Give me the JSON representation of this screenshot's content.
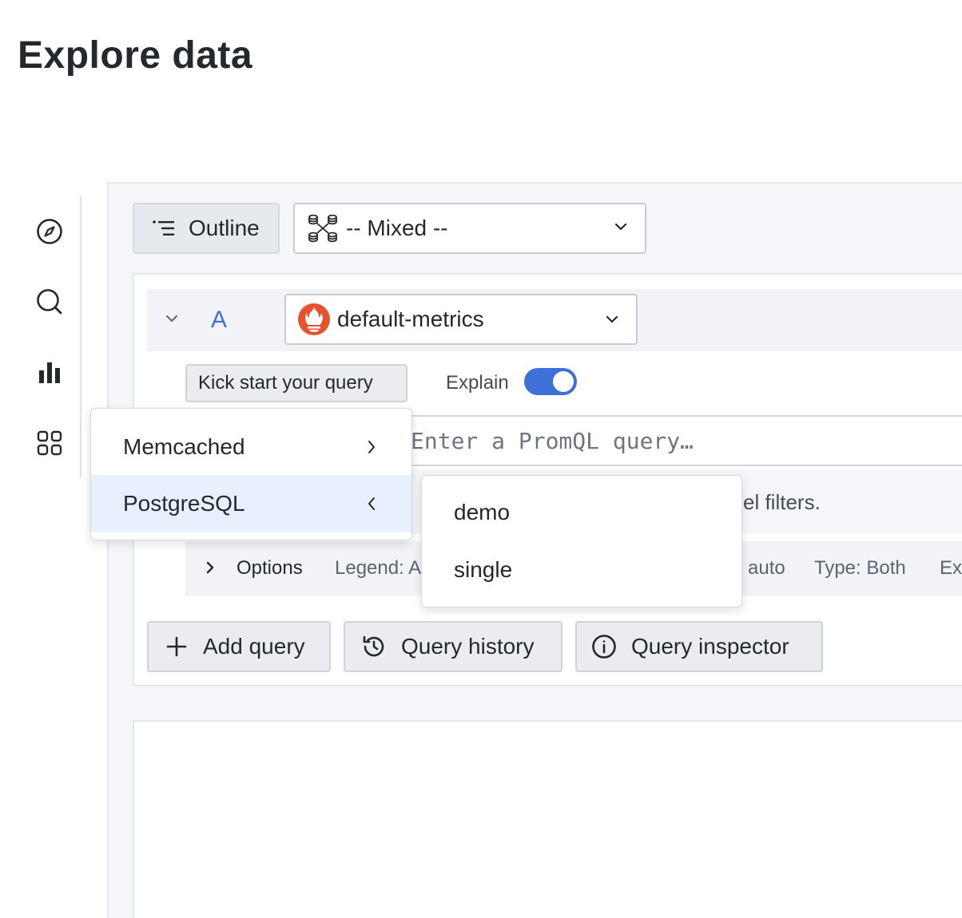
{
  "page": {
    "title": "Explore data"
  },
  "rail": {
    "items": [
      {
        "icon": "compass-icon"
      },
      {
        "icon": "search-icon"
      },
      {
        "icon": "bar-chart-icon"
      },
      {
        "icon": "apps-grid-icon"
      }
    ]
  },
  "toolbar": {
    "outline_label": "Outline",
    "datasource_label": "-- Mixed --"
  },
  "query": {
    "ref_id": "A",
    "datasource_label": "default-metrics",
    "kick_start_label": "Kick start your query",
    "explain_label": "Explain",
    "explain_enabled": true,
    "input_placeholder": "Enter a PromQL query…",
    "hint_visible_text": "el filters.",
    "options": {
      "label": "Options",
      "legend_label": "Legend: A",
      "step_value": "auto",
      "type_label": "Type: Both",
      "extra_label": "Ex"
    }
  },
  "actions": {
    "add_query_label": "Add query",
    "query_history_label": "Query history",
    "query_inspector_label": "Query inspector"
  },
  "kick_start_menu": {
    "items": [
      {
        "label": "Memcached",
        "chevron": "chevron-right-icon",
        "active": false
      },
      {
        "label": "PostgreSQL",
        "chevron": "chevron-left-icon",
        "active": true
      }
    ]
  },
  "submenu": {
    "items": [
      {
        "label": "demo"
      },
      {
        "label": "single"
      }
    ]
  },
  "colors": {
    "accent": "#3d71d9",
    "active_menu_bg": "#e8effd",
    "prometheus": "#e6522c"
  }
}
